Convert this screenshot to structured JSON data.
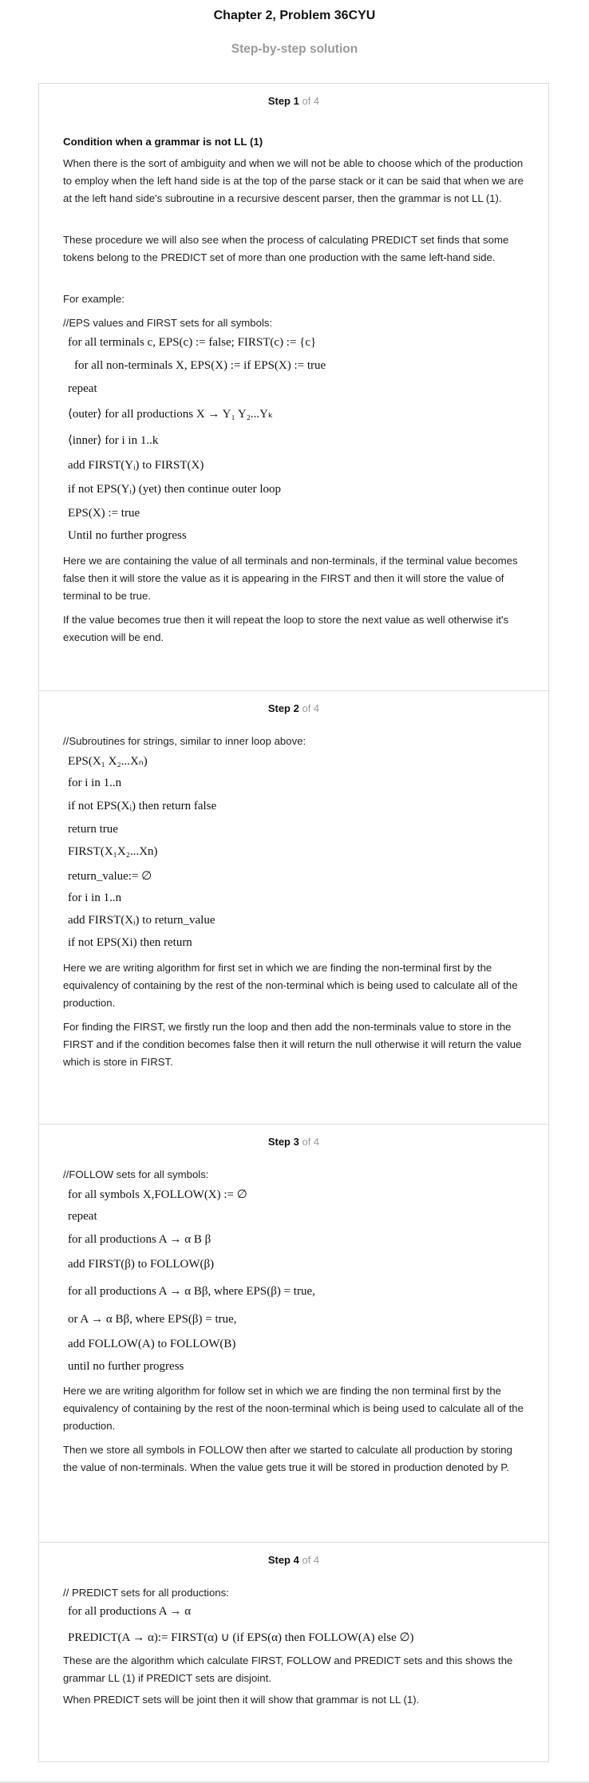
{
  "header": {
    "title": "Chapter 2, Problem 36CYU",
    "subtitle": "Step-by-step solution"
  },
  "steps": [
    {
      "label": "Step 1",
      "of": "of 4",
      "heading": "Condition when a grammar is not LL (1)",
      "p1": "When there is the sort of ambiguity and when we will not be able to choose which of the production to employ when the left hand side is at the top of the parse stack or it can be said that when we are at the left hand side's subroutine in a recursive descent parser, then the grammar is not LL (1).",
      "p2": "These procedure we will also see when the process of calculating PREDICT set finds that some tokens belong to the PREDICT set of more than one production with the same left-hand side.",
      "p3": "For example:",
      "p4": "//EPS values and FIRST sets for all symbols:",
      "code": [
        "for all terminals c, EPS(c) := false; FIRST(c) := {c}",
        "for all non-terminals X, EPS(X) := if EPS(X) := true",
        "repeat",
        "⟨outer⟩ for all productions X → Y₁ Y₂...Yₖ",
        "⟨inner⟩ for i in 1..k",
        "add FIRST(Yᵢ) to FIRST(X)",
        "if not EPS(Yᵢ) (yet) then continue outer loop",
        "EPS(X) := true",
        "Until no further progress"
      ],
      "p5": "Here we are containing the value of all terminals and non-terminals, if the terminal value becomes false then it will store the value as it is appearing in the FIRST and then it will store the value of terminal to be true.",
      "p6": "If the value becomes true then it will repeat the loop to store the next value as well otherwise it's execution will be end."
    },
    {
      "label": "Step 2",
      "of": "of 4",
      "p1": "//Subroutines for strings, similar to inner loop above:",
      "code": [
        "EPS(X₁ X₂...Xₙ)",
        "for i in 1..n",
        "if not EPS(Xᵢ) then return false",
        "return true",
        "FIRST(X₁X₂...Xn)",
        "return_value:= ∅",
        "for i in 1..n",
        "add FIRST(Xᵢ) to return_value",
        "if not EPS(Xi) then return"
      ],
      "p2": "Here we are writing algorithm for first set in which we are finding the non-terminal first by the equivalency of containing by the rest of the non-terminal which is being used to calculate all of the production.",
      "p3": "For finding the FIRST, we firstly run the loop and then add the non-terminals value to store in the FIRST and if the condition becomes false then it will return the null otherwise it will return the value which is store in FIRST."
    },
    {
      "label": "Step 3",
      "of": "of 4",
      "p1": "//FOLLOW sets for all symbols:",
      "code": [
        "for all symbols X,FOLLOW(X) := ∅",
        "repeat",
        "for all productions A → α B β",
        "add FIRST(β) to FOLLOW(β)",
        "for all productions A → α Bβ, where EPS(β) = true,",
        "or A → α Bβ, where EPS(β) = true,",
        "add FOLLOW(A) to FOLLOW(B)",
        "until no further progress"
      ],
      "p2": "Here we are writing algorithm for follow set in which we are finding the non terminal first by the equivalency of containing by the rest of the noon-terminal which is being used to calculate all of the production.",
      "p3": "Then we store all symbols in FOLLOW then after we started to calculate all production by storing the value of non-terminals. When the value gets true it will be stored in production denoted by P."
    },
    {
      "label": "Step 4",
      "of": "of 4",
      "p1": "// PREDICT sets for all productions:",
      "code": [
        "for all productions A → α",
        "PREDICT(A → α):= FIRST(α) ∪ (if EPS(α) then FOLLOW(A) else ∅)"
      ],
      "p2": "These are the algorithm which calculate FIRST, FOLLOW and PREDICT sets and this shows the grammar LL (1) if PREDICT sets are disjoint.",
      "p3": "When PREDICT sets will be joint then it will show that grammar is not LL (1)."
    }
  ]
}
